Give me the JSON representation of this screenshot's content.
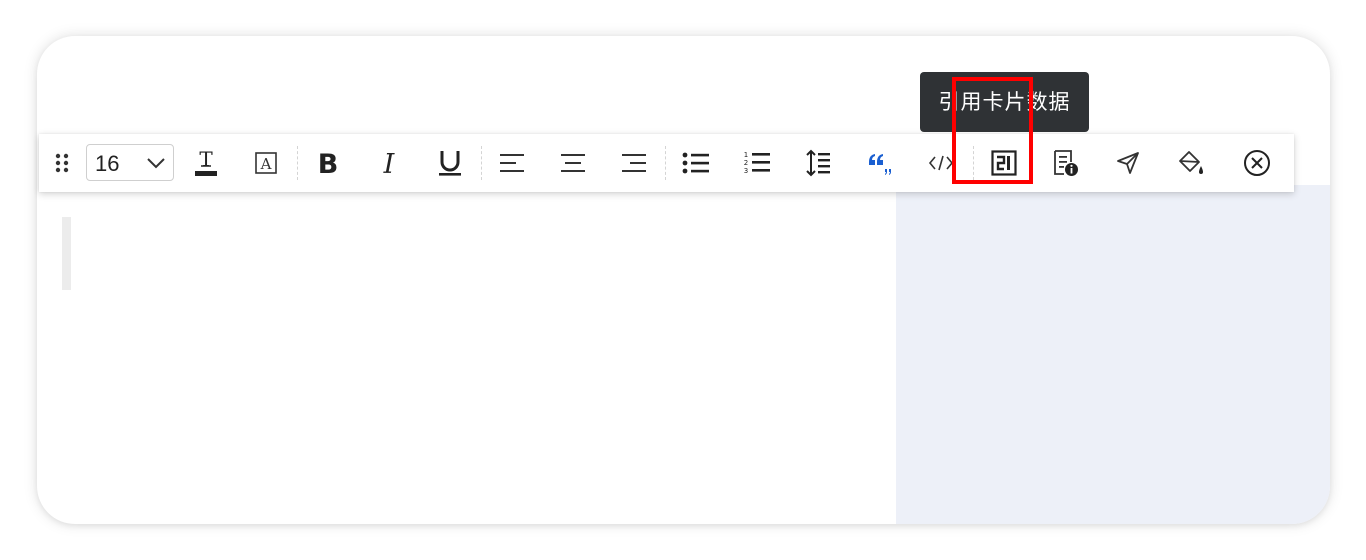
{
  "tooltip": {
    "text": "引用卡片数据"
  },
  "toolbar": {
    "font_size": {
      "value": "16"
    },
    "buttons": [
      {
        "name": "drag-handle",
        "icon": "drag-dots-icon"
      },
      {
        "name": "font-size-select",
        "icon": "chevron-down-icon"
      },
      {
        "name": "text-color",
        "icon": "text-color-icon"
      },
      {
        "name": "text-background",
        "icon": "text-background-icon"
      },
      {
        "name": "bold",
        "icon": "bold-icon"
      },
      {
        "name": "italic",
        "icon": "italic-icon"
      },
      {
        "name": "underline",
        "icon": "underline-icon"
      },
      {
        "name": "align-left",
        "icon": "align-left-icon"
      },
      {
        "name": "align-center",
        "icon": "align-center-icon"
      },
      {
        "name": "align-right",
        "icon": "align-right-icon"
      },
      {
        "name": "bullet-list",
        "icon": "bullet-list-icon"
      },
      {
        "name": "ordered-list",
        "icon": "ordered-list-icon"
      },
      {
        "name": "line-height",
        "icon": "line-height-icon"
      },
      {
        "name": "quote",
        "icon": "quote-icon"
      },
      {
        "name": "code",
        "icon": "code-icon"
      },
      {
        "name": "reference-card-data",
        "icon": "reference-card-icon"
      },
      {
        "name": "card-info",
        "icon": "document-info-icon"
      },
      {
        "name": "send",
        "icon": "send-icon"
      },
      {
        "name": "fill-color",
        "icon": "paint-bucket-icon"
      },
      {
        "name": "close",
        "icon": "close-circle-icon"
      }
    ]
  },
  "colors": {
    "tooltip_bg": "#2f3235",
    "quote_accent": "#1a5fd1",
    "side_panel_bg": "#edf0f8",
    "highlight_border": "#ff0000"
  }
}
